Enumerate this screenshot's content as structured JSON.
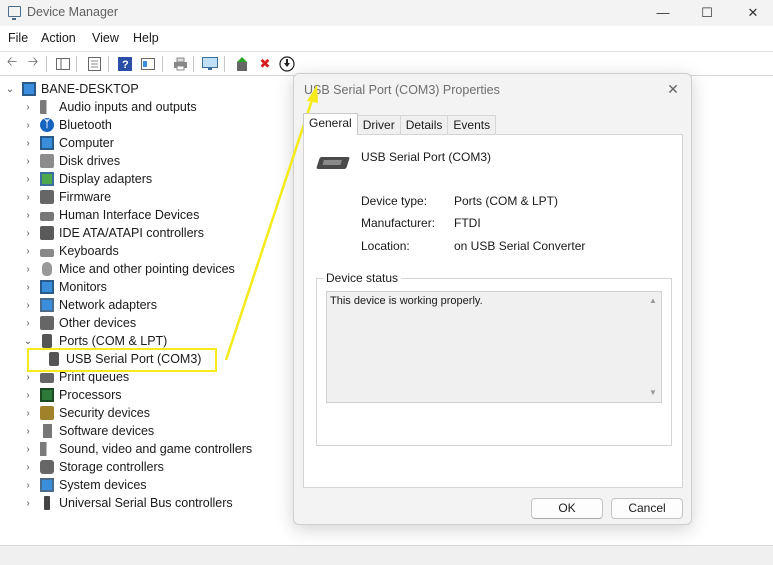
{
  "window": {
    "title": "Device Manager"
  },
  "menu": [
    "File",
    "Action",
    "View",
    "Help"
  ],
  "tree": {
    "root": "BANE-DESKTOP",
    "categories": [
      {
        "label": "Audio inputs and outputs",
        "icon": "speaker-icon"
      },
      {
        "label": "Bluetooth",
        "icon": "bluetooth-icon"
      },
      {
        "label": "Computer",
        "icon": "computer-icon"
      },
      {
        "label": "Disk drives",
        "icon": "disk-drive-icon"
      },
      {
        "label": "Display adapters",
        "icon": "display-adapter-icon"
      },
      {
        "label": "Firmware",
        "icon": "firmware-icon"
      },
      {
        "label": "Human Interface Devices",
        "icon": "hid-icon"
      },
      {
        "label": "IDE ATA/ATAPI controllers",
        "icon": "ide-controller-icon"
      },
      {
        "label": "Keyboards",
        "icon": "keyboard-icon"
      },
      {
        "label": "Mice and other pointing devices",
        "icon": "mouse-icon"
      },
      {
        "label": "Monitors",
        "icon": "monitor-icon"
      },
      {
        "label": "Network adapters",
        "icon": "network-adapter-icon"
      },
      {
        "label": "Other devices",
        "icon": "other-device-icon"
      },
      {
        "label": "Ports (COM & LPT)",
        "icon": "port-icon"
      },
      {
        "label": "USB Serial Port (COM3)",
        "icon": "port-icon"
      },
      {
        "label": "Print queues",
        "icon": "printer-icon"
      },
      {
        "label": "Processors",
        "icon": "processor-icon"
      },
      {
        "label": "Security devices",
        "icon": "security-device-icon"
      },
      {
        "label": "Software devices",
        "icon": "software-device-icon"
      },
      {
        "label": "Sound, video and game controllers",
        "icon": "sound-icon"
      },
      {
        "label": "Storage controllers",
        "icon": "storage-controller-icon"
      },
      {
        "label": "System devices",
        "icon": "system-device-icon"
      },
      {
        "label": "Universal Serial Bus controllers",
        "icon": "usb-icon"
      }
    ]
  },
  "dialog": {
    "title": "USB Serial Port (COM3) Properties",
    "tabs": [
      "General",
      "Driver",
      "Details",
      "Events"
    ],
    "active_tab": "General",
    "device_name": "USB Serial Port (COM3)",
    "properties": [
      {
        "label": "Device type:",
        "value": "Ports (COM & LPT)"
      },
      {
        "label": "Manufacturer:",
        "value": "FTDI"
      },
      {
        "label": "Location:",
        "value": "on USB Serial Converter"
      }
    ],
    "status_group_label": "Device status",
    "status_text": "This device is working properly.",
    "ok_label": "OK",
    "cancel_label": "Cancel"
  },
  "colors": {
    "highlight": "#f5ea1a",
    "accent": "#1664c0"
  }
}
